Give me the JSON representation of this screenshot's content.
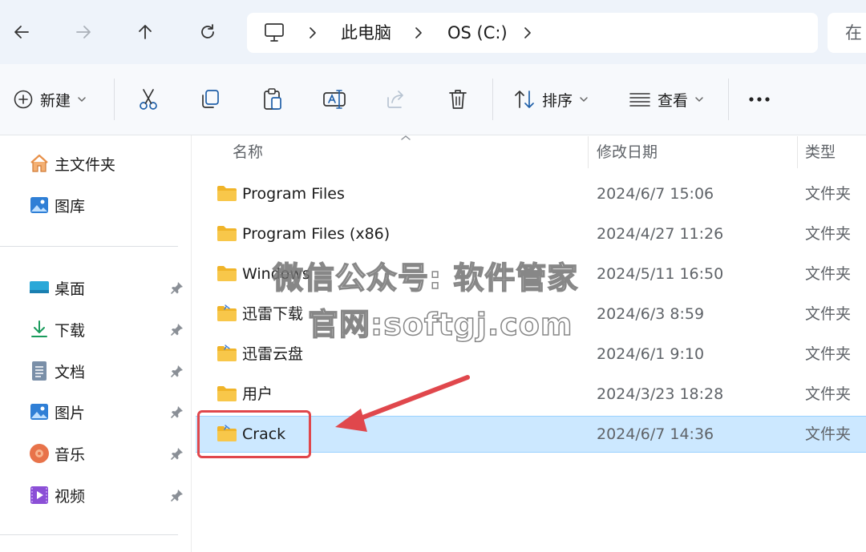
{
  "address_bar": {
    "crumbs": [
      "此电脑",
      "OS (C:)"
    ],
    "search_placeholder": "在"
  },
  "toolbar": {
    "new_label": "新建",
    "sort_label": "排序",
    "view_label": "查看"
  },
  "nav": {
    "top_items": [
      {
        "label": "主文件夹",
        "icon": "home-icon"
      },
      {
        "label": "图库",
        "icon": "gallery-icon"
      }
    ],
    "quick_access": [
      {
        "label": "桌面",
        "icon": "desktop-icon"
      },
      {
        "label": "下载",
        "icon": "download-icon"
      },
      {
        "label": "文档",
        "icon": "documents-icon"
      },
      {
        "label": "图片",
        "icon": "pictures-icon"
      },
      {
        "label": "音乐",
        "icon": "music-icon"
      },
      {
        "label": "视频",
        "icon": "videos-icon"
      }
    ]
  },
  "list": {
    "columns": {
      "name": "名称",
      "modified": "修改日期",
      "type": "类型"
    },
    "rows": [
      {
        "name": "Program Files",
        "modified": "2024/6/7 15:06",
        "type": "文件夹",
        "selected": false
      },
      {
        "name": "Program Files (x86)",
        "modified": "2024/4/27 11:26",
        "type": "文件夹",
        "selected": false
      },
      {
        "name": "Windows",
        "modified": "2024/5/11 16:50",
        "type": "文件夹",
        "selected": false
      },
      {
        "name": "迅雷下载",
        "modified": "2024/6/3 8:59",
        "type": "文件夹",
        "selected": false
      },
      {
        "name": "迅雷云盘",
        "modified": "2024/6/1 9:10",
        "type": "文件夹",
        "selected": false
      },
      {
        "name": "用户",
        "modified": "2024/3/23 18:28",
        "type": "文件夹",
        "selected": false
      },
      {
        "name": "Crack",
        "modified": "2024/6/7 14:36",
        "type": "文件夹",
        "selected": true
      }
    ]
  },
  "watermark": {
    "line1": "微信公众号: 软件管家",
    "line2": "官网:softgj.com"
  },
  "colors": {
    "accent": "#0078d4",
    "selection": "#cce8ff",
    "folder": "#f8c74a",
    "annotation": "#e0474c"
  }
}
